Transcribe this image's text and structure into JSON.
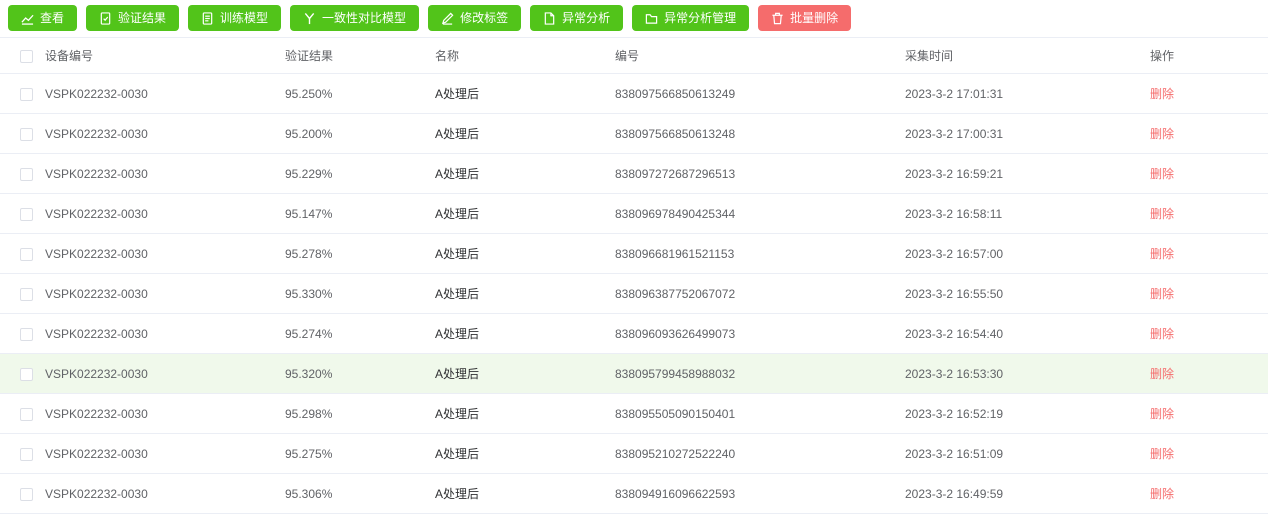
{
  "colors": {
    "primary_green": "#52c41a",
    "danger_red": "#f56c6c",
    "highlight_row": "#f0f9eb",
    "border": "#ebeef5"
  },
  "toolbar": {
    "buttons": [
      {
        "name": "view-button",
        "label": "查看",
        "icon": "chart-line-icon",
        "type": "primary"
      },
      {
        "name": "verify-result-button",
        "label": "验证结果",
        "icon": "checklist-icon",
        "type": "primary"
      },
      {
        "name": "train-model-button",
        "label": "训练模型",
        "icon": "document-icon",
        "type": "primary"
      },
      {
        "name": "consistency-compare-model-button",
        "label": "一致性对比模型",
        "icon": "branch-icon",
        "type": "primary"
      },
      {
        "name": "edit-label-button",
        "label": "修改标签",
        "icon": "edit-icon",
        "type": "primary"
      },
      {
        "name": "anomaly-analysis-button",
        "label": "异常分析",
        "icon": "file-icon",
        "type": "primary"
      },
      {
        "name": "anomaly-analysis-manage-button",
        "label": "异常分析管理",
        "icon": "folder-icon",
        "type": "primary"
      },
      {
        "name": "batch-delete-button",
        "label": "批量删除",
        "icon": "trash-icon",
        "type": "danger"
      }
    ]
  },
  "table": {
    "columns": [
      {
        "key": "device",
        "label": "设备编号"
      },
      {
        "key": "result",
        "label": "验证结果"
      },
      {
        "key": "name",
        "label": "名称"
      },
      {
        "key": "number",
        "label": "编号"
      },
      {
        "key": "time",
        "label": "采集时间"
      },
      {
        "key": "action",
        "label": "操作"
      }
    ],
    "action_label": "删除",
    "rows": [
      {
        "device": "VSPK022232-0030",
        "result": "95.250%",
        "name": "A处理后",
        "number": "838097566850613249",
        "time": "2023-3-2 17:01:31",
        "highlighted": false
      },
      {
        "device": "VSPK022232-0030",
        "result": "95.200%",
        "name": "A处理后",
        "number": "838097566850613248",
        "time": "2023-3-2 17:00:31",
        "highlighted": false
      },
      {
        "device": "VSPK022232-0030",
        "result": "95.229%",
        "name": "A处理后",
        "number": "838097272687296513",
        "time": "2023-3-2 16:59:21",
        "highlighted": false
      },
      {
        "device": "VSPK022232-0030",
        "result": "95.147%",
        "name": "A处理后",
        "number": "838096978490425344",
        "time": "2023-3-2 16:58:11",
        "highlighted": false
      },
      {
        "device": "VSPK022232-0030",
        "result": "95.278%",
        "name": "A处理后",
        "number": "838096681961521153",
        "time": "2023-3-2 16:57:00",
        "highlighted": false
      },
      {
        "device": "VSPK022232-0030",
        "result": "95.330%",
        "name": "A处理后",
        "number": "838096387752067072",
        "time": "2023-3-2 16:55:50",
        "highlighted": false
      },
      {
        "device": "VSPK022232-0030",
        "result": "95.274%",
        "name": "A处理后",
        "number": "838096093626499073",
        "time": "2023-3-2 16:54:40",
        "highlighted": false
      },
      {
        "device": "VSPK022232-0030",
        "result": "95.320%",
        "name": "A处理后",
        "number": "838095799458988032",
        "time": "2023-3-2 16:53:30",
        "highlighted": true
      },
      {
        "device": "VSPK022232-0030",
        "result": "95.298%",
        "name": "A处理后",
        "number": "838095505090150401",
        "time": "2023-3-2 16:52:19",
        "highlighted": false
      },
      {
        "device": "VSPK022232-0030",
        "result": "95.275%",
        "name": "A处理后",
        "number": "838095210272522240",
        "time": "2023-3-2 16:51:09",
        "highlighted": false
      },
      {
        "device": "VSPK022232-0030",
        "result": "95.306%",
        "name": "A处理后",
        "number": "838094916096622593",
        "time": "2023-3-2 16:49:59",
        "highlighted": false
      }
    ]
  }
}
